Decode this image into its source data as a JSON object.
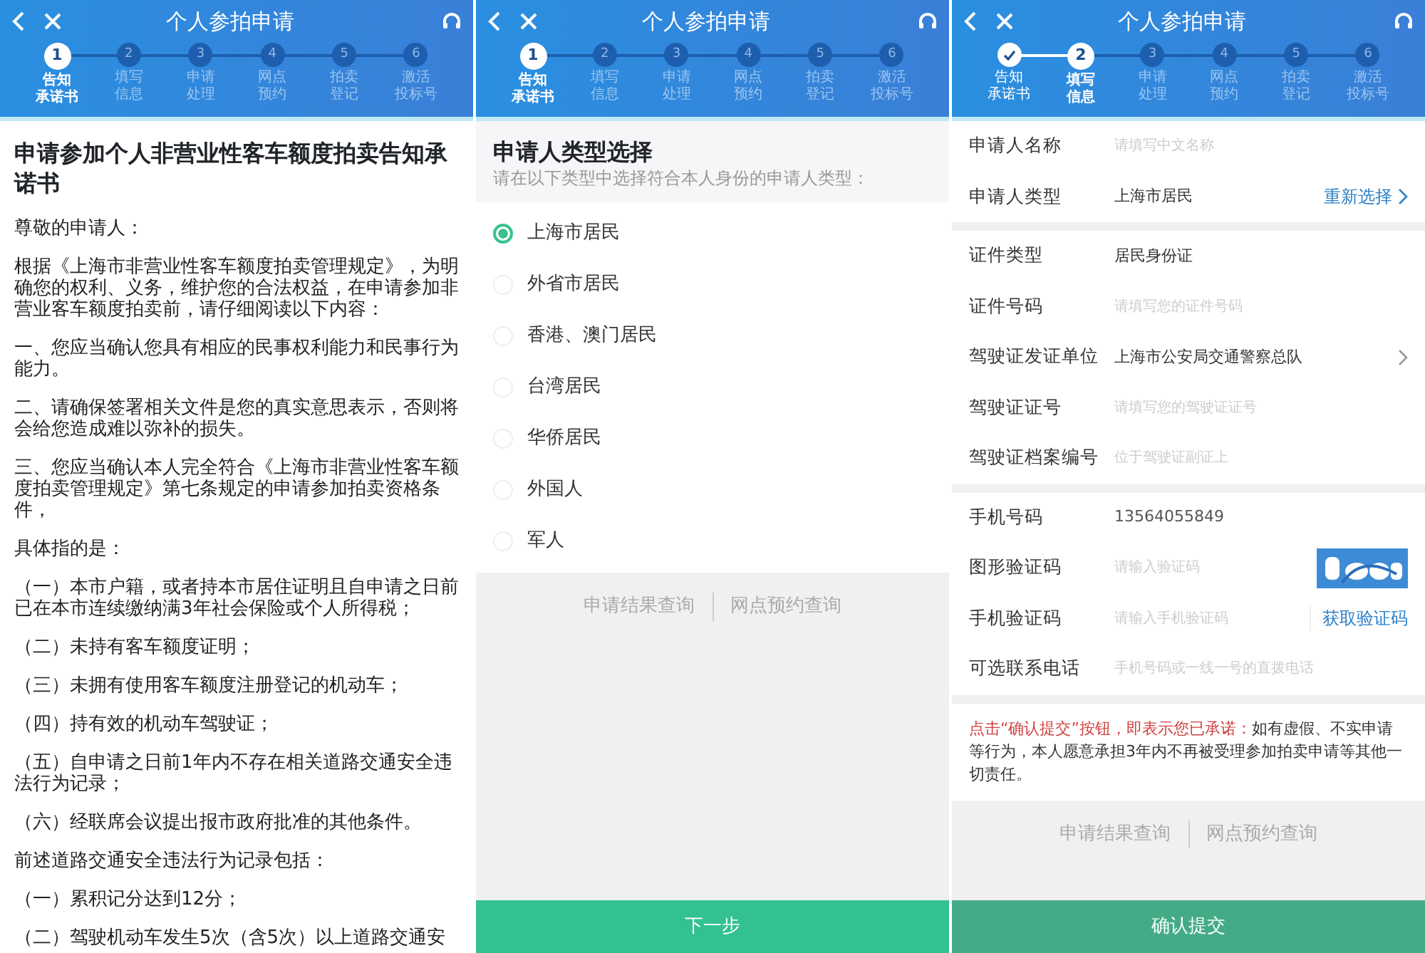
{
  "screens": [
    {
      "title": "个人参拍申请",
      "steps": [
        {
          "number": "1",
          "label": [
            "告知",
            "承诺书"
          ],
          "done": false,
          "selected": true
        },
        {
          "number": "2",
          "label": [
            "填写",
            "信息"
          ],
          "done": false,
          "selected": false
        },
        {
          "number": "3",
          "label": [
            "申请",
            "处理"
          ],
          "done": false,
          "selected": false
        },
        {
          "number": "4",
          "label": [
            "网点",
            "预约"
          ],
          "done": false,
          "selected": false
        },
        {
          "number": "5",
          "label": [
            "拍卖",
            "登记"
          ],
          "done": false,
          "selected": false
        },
        {
          "number": "6",
          "label": [
            "激活",
            "投标号"
          ],
          "done": false,
          "selected": false
        }
      ],
      "kind": "notice",
      "heading": "申请参加个人非营业性客车额度拍卖告知承诺书",
      "paragraphs": [
        "尊敬的申请人：",
        "根据《上海市非营业性客车额度拍卖管理规定》，为明确您的权利、义务，维护您的合法权益，在申请参加非营业客车额度拍卖前，请仔细阅读以下内容：",
        "一、您应当确认您具有相应的民事权利能力和民事行为能力。",
        "二、请确保签署相关文件是您的真实意思表示，否则将会给您造成难以弥补的损失。",
        "三、您应当确认本人完全符合《上海市非营业性客车额度拍卖管理规定》第七条规定的申请参加拍卖资格条件，",
        "具体指的是：",
        "（一）本市户籍，或者持本市居住证明且自申请之日前已在本市连续缴纳满3年社会保险或个人所得税；",
        "（二）未持有客车额度证明；",
        "（三）未拥有使用客车额度注册登记的机动车；",
        "（四）持有效的机动车驾驶证；",
        "（五）自申请之日前1年内不存在相关道路交通安全违法行为记录；",
        "（六）经联席会议提出报市政府批准的其他条件。",
        "前述道路交通安全违法行为记录包括：",
        "（一）累积记分达到12分；",
        "（二）驾驶机动车发生5次（含5次）以上道路交通安"
      ]
    },
    {
      "title": "个人参拍申请",
      "steps": [
        {
          "number": "1",
          "label": [
            "告知",
            "承诺书"
          ],
          "done": false,
          "selected": true
        },
        {
          "number": "2",
          "label": [
            "填写",
            "信息"
          ],
          "done": false,
          "selected": false
        },
        {
          "number": "3",
          "label": [
            "申请",
            "处理"
          ],
          "done": false,
          "selected": false
        },
        {
          "number": "4",
          "label": [
            "网点",
            "预约"
          ],
          "done": false,
          "selected": false
        },
        {
          "number": "5",
          "label": [
            "拍卖",
            "登记"
          ],
          "done": false,
          "selected": false
        },
        {
          "number": "6",
          "label": [
            "激活",
            "投标号"
          ],
          "done": false,
          "selected": false
        }
      ],
      "kind": "choice",
      "heading": "申请人类型选择",
      "subheading": "请在以下类型中选择符合本人身份的申请人类型：",
      "options": [
        {
          "label": "上海市居民",
          "selected": true
        },
        {
          "label": "外省市居民",
          "selected": false
        },
        {
          "label": "香港、澳门居民",
          "selected": false
        },
        {
          "label": "台湾居民",
          "selected": false
        },
        {
          "label": "华侨居民",
          "selected": false
        },
        {
          "label": "外国人",
          "selected": false
        },
        {
          "label": "军人",
          "selected": false
        }
      ],
      "links": [
        "申请结果查询",
        "网点预约查询"
      ],
      "button": {
        "label": "下一步",
        "disabled": false
      }
    },
    {
      "title": "个人参拍申请",
      "steps": [
        {
          "label": [
            "告知",
            "承诺书"
          ],
          "done": true,
          "selected": false
        },
        {
          "number": "2",
          "label": [
            "填写",
            "信息"
          ],
          "done": false,
          "selected": true
        },
        {
          "number": "3",
          "label": [
            "申请",
            "处理"
          ],
          "done": false,
          "selected": false
        },
        {
          "number": "4",
          "label": [
            "网点",
            "预约"
          ],
          "done": false,
          "selected": false
        },
        {
          "number": "5",
          "label": [
            "拍卖",
            "登记"
          ],
          "done": false,
          "selected": false
        },
        {
          "number": "6",
          "label": [
            "激活",
            "投标号"
          ],
          "done": false,
          "selected": false
        }
      ],
      "kind": "form",
      "groups": [
        [
          {
            "label": "申请人名称",
            "kind": "input",
            "placeholder": "请填写中文名称"
          },
          {
            "label": "申请人类型",
            "kind": "action",
            "value": "上海市居民",
            "action": "重新选择"
          }
        ],
        [
          {
            "label": "证件类型",
            "kind": "value",
            "value": "居民身份证"
          },
          {
            "label": "证件号码",
            "kind": "input",
            "placeholder": "请填写您的证件号码"
          },
          {
            "label": "驾驶证发证单位",
            "kind": "select",
            "value": "上海市公安局交通警察总队"
          },
          {
            "label": "驾驶证证号",
            "kind": "input",
            "placeholder": "请填写您的驾驶证证号"
          },
          {
            "label": "驾驶证档案编号",
            "kind": "input",
            "placeholder": "位于驾驶证副证上"
          }
        ],
        [
          {
            "label": "手机号码",
            "kind": "blurred",
            "value": "13564055849"
          },
          {
            "label": "图形验证码",
            "kind": "captcha",
            "placeholder": "请输入验证码"
          },
          {
            "label": "手机验证码",
            "kind": "sms",
            "placeholder": "请输入手机验证码",
            "action": "获取验证码"
          },
          {
            "label": "可选联系电话",
            "kind": "input",
            "placeholder": "手机号码或一线一号的直拨电话"
          }
        ]
      ],
      "notice": "**点击“确认提交”按钮，即表示您已承诺：**如有虚假、不实申请等行为，本人愿意承担3年内不再被受理参加拍卖申请等其他一切责任。",
      "links": [
        "申请结果查询",
        "网点预约查询"
      ],
      "button": {
        "label": "确认提交",
        "disabled": true
      }
    }
  ]
}
